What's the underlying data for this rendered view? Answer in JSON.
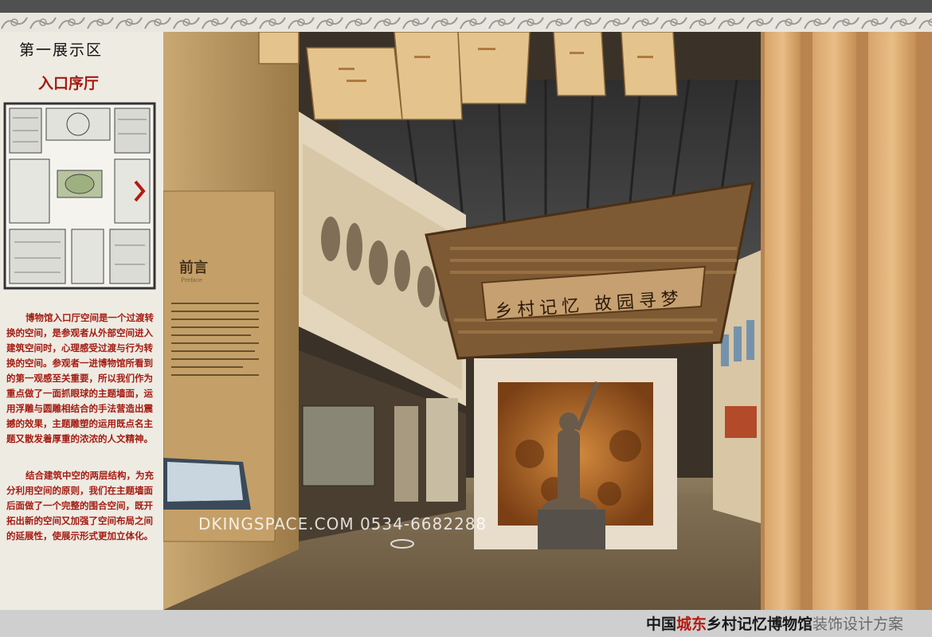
{
  "zone_title": "第一展示区",
  "hall_title": "入口序厅",
  "description": [
    "博物馆入口厅空间是一个过渡转换的空间，是参观者从外部空间进入建筑空间时，心理感受过渡与行为转换的空间。参观者一进博物馆所看到的第一观感至关重要，所以我们作为重点做了一面抓眼球的主题墙面，运用浮雕与圆雕相结合的手法营造出震撼的效果，主题雕塑的运用既点名主题又散发着厚重的浓浓的人文精神。",
    "结合建筑中空的两层结构，为充分利用空间的原则，我们在主题墙面后面做了一个完整的围合空间，既开拓出新的空间又加强了空间布局之间的延展性，使展示形式更加立体化。"
  ],
  "scene": {
    "preface_title": "前言",
    "preface_subtitle": "Preface",
    "slogan": "乡村记忆  故园寻梦",
    "watermark": "DKINGSPACE.COM  0534-6682288"
  },
  "footer": {
    "part1": "中国",
    "part2": "城东",
    "part3": "乡村记忆博物馆",
    "part4": "装饰设计方案"
  },
  "colors": {
    "accent_red": "#a41c12",
    "ceiling_dark": "#2b2b2b",
    "wall_warm": "#c79a5c"
  }
}
